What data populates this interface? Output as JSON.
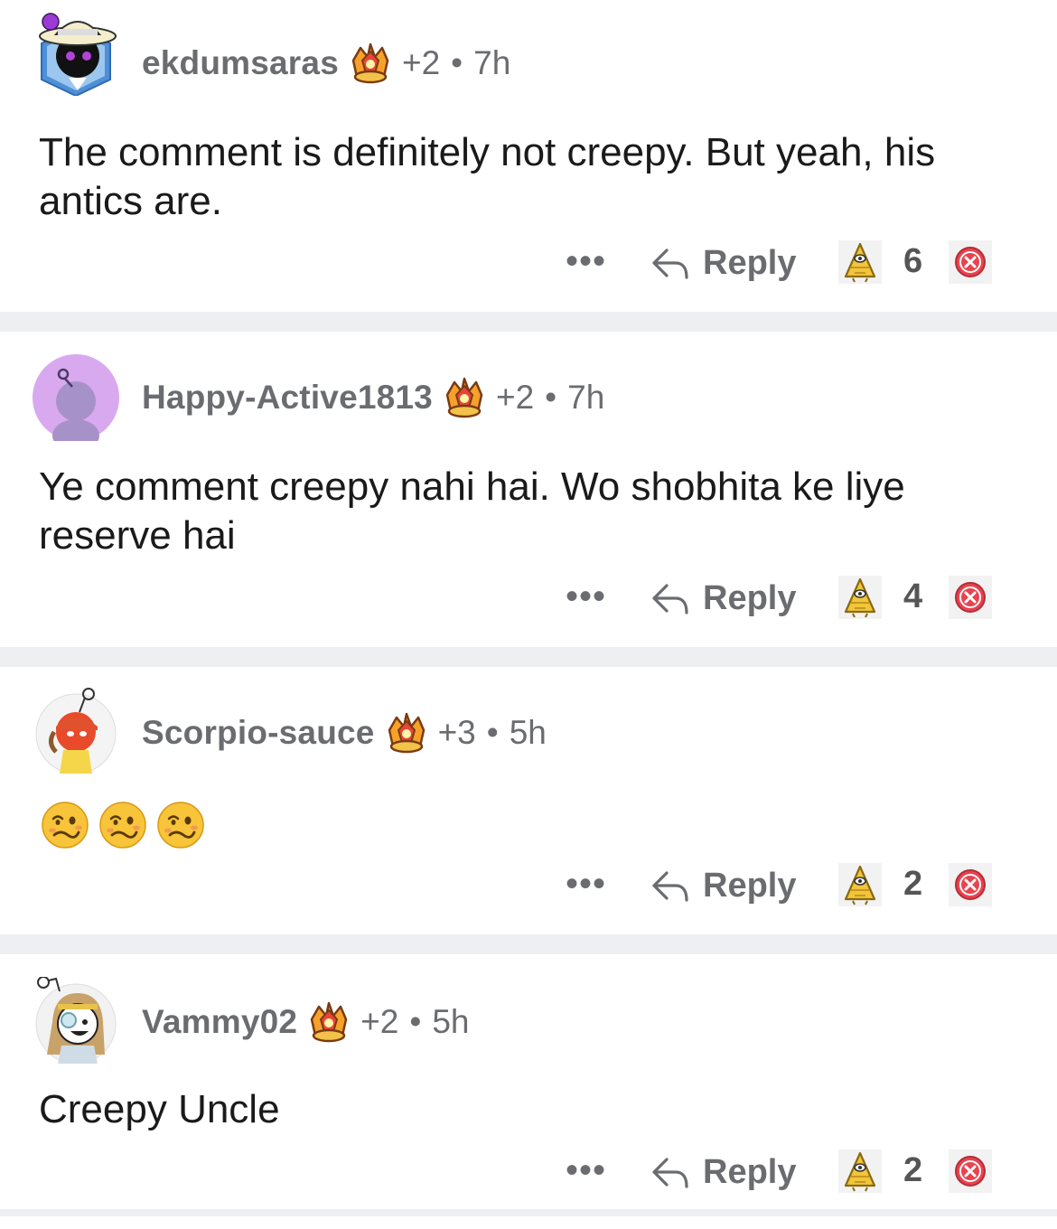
{
  "colors": {
    "meta": "#6a6c70",
    "text": "#1a1a1b",
    "separator": "#eeeff1",
    "downvote": "#e8434e"
  },
  "comments": [
    {
      "username": "ekdumsaras",
      "karma": "+2",
      "separator": "•",
      "time": "7h",
      "text": "The comment is definitely not creepy. But yeah, his antics  are.",
      "more": "•••",
      "reply_label": "Reply",
      "votes": "6"
    },
    {
      "username": "Happy-Active1813",
      "karma": "+2",
      "separator": "•",
      "time": "7h",
      "text": "Ye comment creepy nahi hai. Wo shobhita ke liye reserve hai",
      "more": "•••",
      "reply_label": "Reply",
      "votes": "4"
    },
    {
      "username": "Scorpio-sauce",
      "karma": "+3",
      "separator": "•",
      "time": "5h",
      "emoji_count_icon": "woozy-face-icon",
      "more": "•••",
      "reply_label": "Reply",
      "votes": "2"
    },
    {
      "username": "Vammy02",
      "karma": "+2",
      "separator": "•",
      "time": "5h",
      "text": "Creepy Uncle",
      "more": "•••",
      "reply_label": "Reply",
      "votes": "2"
    }
  ]
}
